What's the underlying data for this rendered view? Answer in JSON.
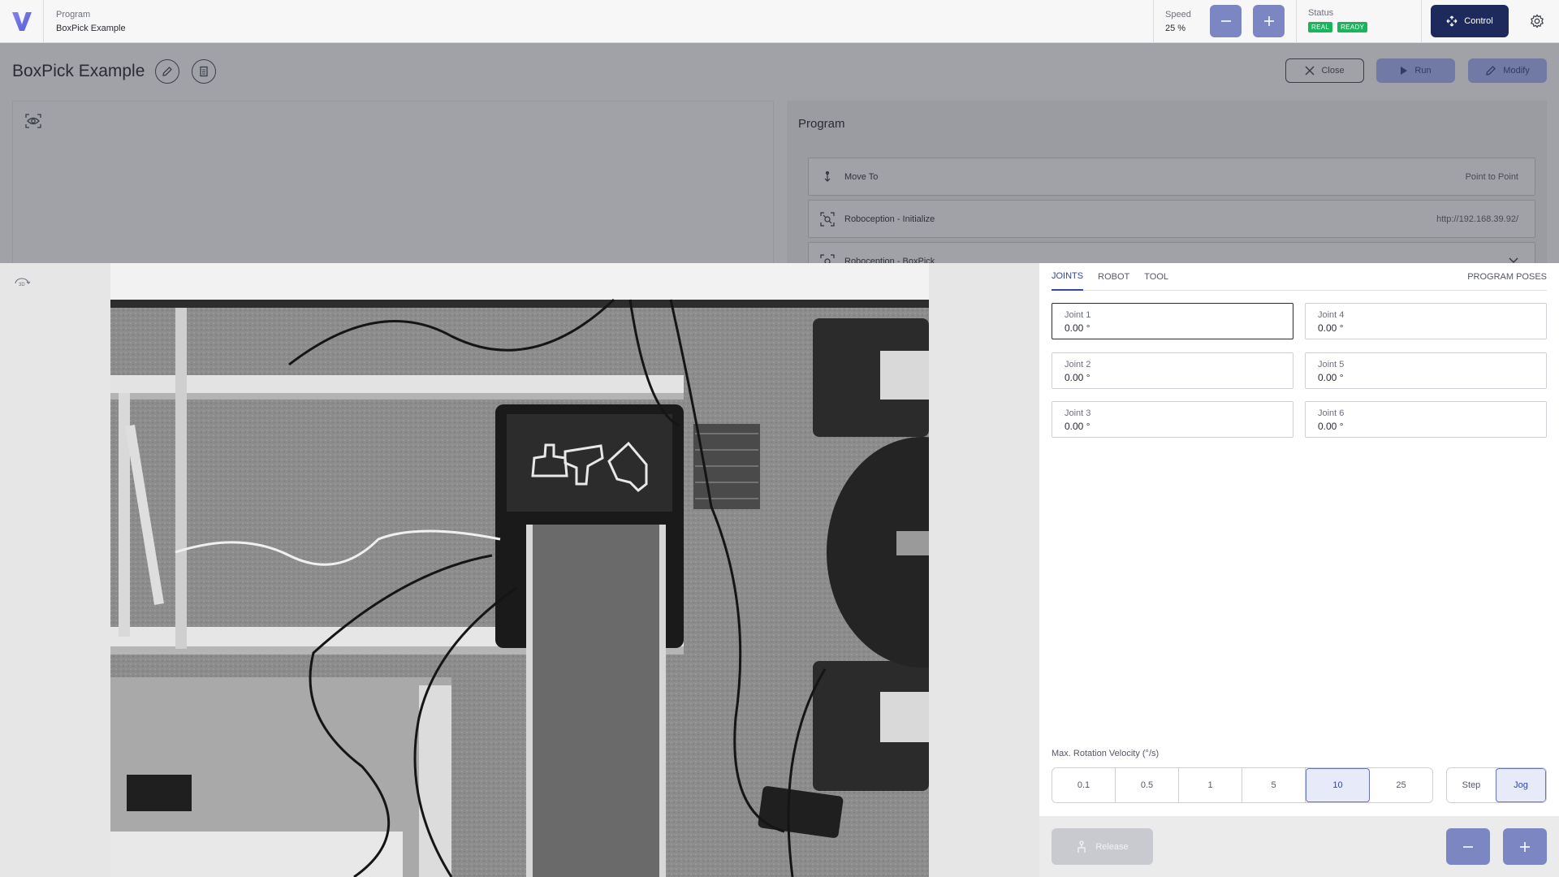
{
  "header": {
    "program_label": "Program",
    "program_name": "BoxPick Example",
    "speed_label": "Speed",
    "speed_value": "25 %",
    "status_label": "Status",
    "status_badges": [
      "REAL",
      "READY"
    ],
    "control_label": "Control"
  },
  "workspace": {
    "title": "BoxPick Example",
    "close_label": "Close",
    "run_label": "Run",
    "modify_label": "Modify",
    "program_panel_title": "Program",
    "steps": [
      {
        "label": "Move To",
        "detail": "Point to Point",
        "icon": "move-to-icon"
      },
      {
        "label": "Roboception - Initialize",
        "detail": "http://192.168.39.92/",
        "icon": "camera-scan-icon"
      },
      {
        "label": "Roboception - BoxPick",
        "detail": "",
        "icon": "camera-scan-icon"
      }
    ]
  },
  "jog_panel": {
    "tabs": [
      "JOINTS",
      "ROBOT",
      "TOOL"
    ],
    "active_tab": "JOINTS",
    "right_tab": "PROGRAM POSES",
    "joints": [
      {
        "label": "Joint 1",
        "value": "0.00 °"
      },
      {
        "label": "Joint 2",
        "value": "0.00 °"
      },
      {
        "label": "Joint 3",
        "value": "0.00 °"
      },
      {
        "label": "Joint 4",
        "value": "0.00 °"
      },
      {
        "label": "Joint 5",
        "value": "0.00 °"
      },
      {
        "label": "Joint 6",
        "value": "0.00 °"
      }
    ],
    "velocity_label": "Max. Rotation Velocity (°/s)",
    "velocity_options": [
      "0.1",
      "0.5",
      "1",
      "5",
      "10",
      "25"
    ],
    "velocity_selected": "10",
    "mode_options": [
      "Step",
      "Jog"
    ],
    "mode_selected": "Jog",
    "release_label": "Release"
  },
  "colors": {
    "accent": "#7b86c3",
    "control_button": "#1f2a5c",
    "badge_green": "#1cb35f",
    "active_tab": "#3446a0"
  }
}
